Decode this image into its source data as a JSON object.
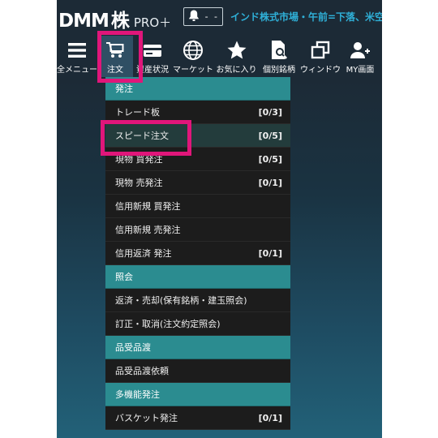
{
  "header": {
    "logo_main": "DMM",
    "logo_kabu": "株",
    "logo_pro": "PRO＋",
    "notification_count": "- -",
    "ticker": "インド株式市場・午前=下落、米空爆"
  },
  "nav": {
    "items": [
      {
        "label": "全メニュー",
        "icon": "hamburger-icon"
      },
      {
        "label": "注文",
        "icon": "cart-icon"
      },
      {
        "label": "資産状況",
        "icon": "wallet-icon"
      },
      {
        "label": "マーケット",
        "icon": "globe-icon"
      },
      {
        "label": "お気に入り",
        "icon": "star-icon"
      },
      {
        "label": "個別銘柄",
        "icon": "document-search-icon"
      },
      {
        "label": "ウィンドウ",
        "icon": "windows-icon"
      },
      {
        "label": "MY画面",
        "icon": "user-add-icon"
      }
    ]
  },
  "menu": {
    "sections": [
      {
        "title": "発注",
        "items": [
          {
            "label": "トレード板",
            "count": "[0/3]"
          },
          {
            "label": "スピード注文",
            "count": "[0/5]",
            "selected": true
          },
          {
            "label": "現物 買発注",
            "count": "[0/5]"
          },
          {
            "label": "現物 売発注",
            "count": "[0/1]"
          },
          {
            "label": "信用新規 買発注",
            "count": ""
          },
          {
            "label": "信用新規 売発注",
            "count": ""
          },
          {
            "label": "信用返済 発注",
            "count": "[0/1]"
          }
        ]
      },
      {
        "title": "照会",
        "items": [
          {
            "label": "返済・売却(保有銘柄・建玉照会)",
            "count": ""
          },
          {
            "label": "訂正・取消(注文約定照会)",
            "count": ""
          }
        ]
      },
      {
        "title": "品受品渡",
        "items": [
          {
            "label": "品受品渡依頼",
            "count": ""
          }
        ]
      },
      {
        "title": "多機能発注",
        "items": [
          {
            "label": "バスケット発注",
            "count": "[0/1]"
          }
        ]
      }
    ]
  },
  "colors": {
    "accent_highlight": "#e0167a",
    "section_header": "#2b8c90",
    "ticker_text": "#2fb0d8",
    "menu_row": "#1c1c1c"
  }
}
